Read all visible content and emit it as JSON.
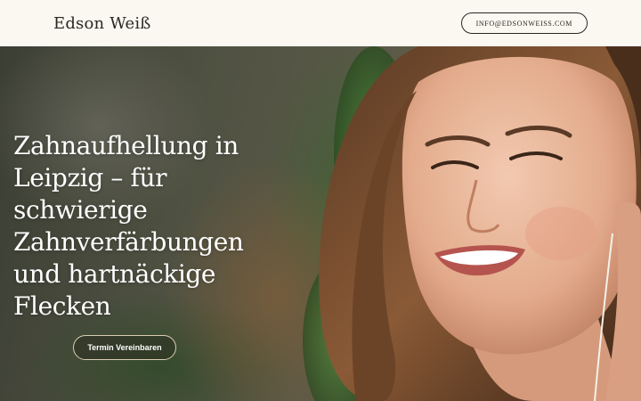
{
  "header": {
    "brand": "Edson Weiß",
    "contact_email": "INFO@EDSONWEISS.COM"
  },
  "hero": {
    "title": "Zahnaufhellung in Leipzig – für schwierige Zahnverfärbungen und hartnäckige Flecken",
    "cta_label": "Termin Vereinbaren"
  },
  "colors": {
    "header_bg": "#fbf8f1",
    "text_dark": "#2b2721",
    "hero_text": "#ffffff"
  }
}
